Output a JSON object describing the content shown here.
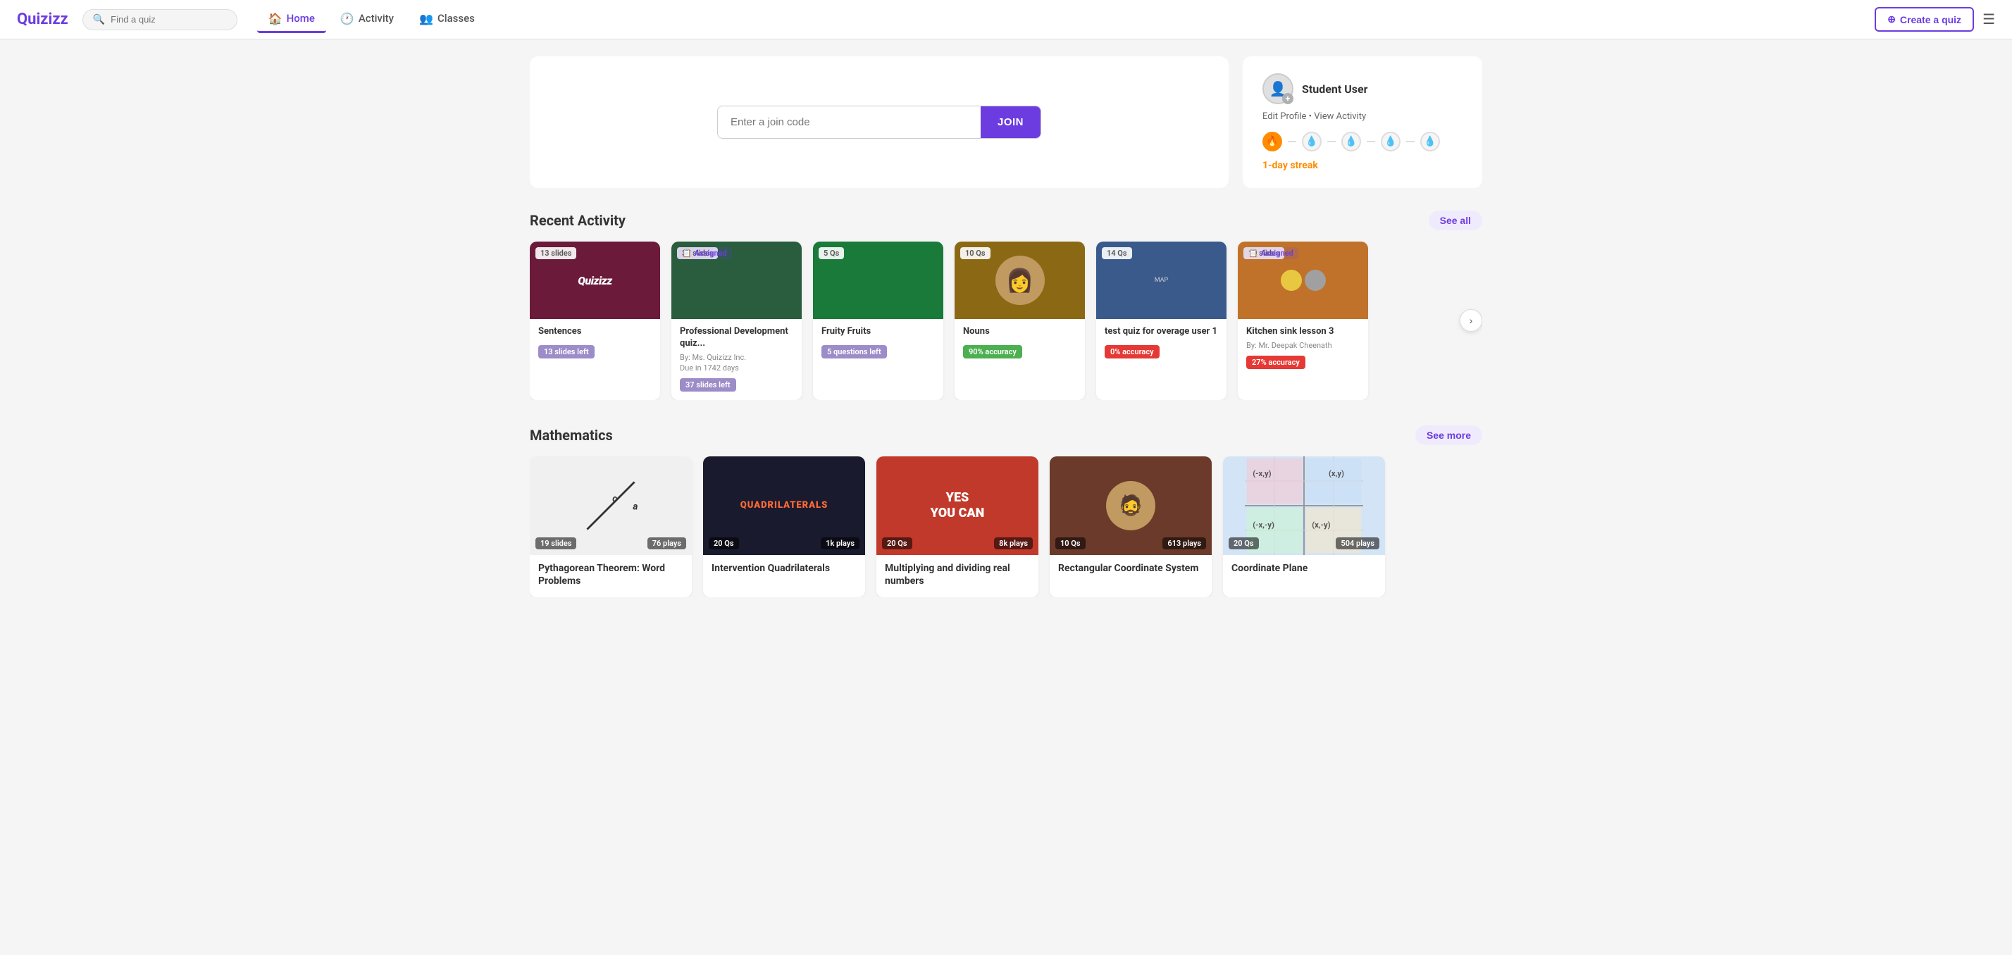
{
  "app": {
    "logo": "Quizizz",
    "search_placeholder": "Find a quiz"
  },
  "navbar": {
    "links": [
      {
        "id": "home",
        "label": "Home",
        "icon": "🏠",
        "active": true
      },
      {
        "id": "activity",
        "label": "Activity",
        "icon": "🕐",
        "active": false
      },
      {
        "id": "classes",
        "label": "Classes",
        "icon": "👥",
        "active": false
      }
    ],
    "create_label": "Create a quiz",
    "menu_icon": "☰"
  },
  "hero": {
    "join_placeholder": "Enter a join code",
    "join_button": "JOIN"
  },
  "profile": {
    "name": "Student User",
    "edit_label": "Edit Profile",
    "view_label": "View Activity",
    "streak_label": "1-day streak",
    "streak_days": [
      {
        "active": true
      },
      {
        "active": false
      },
      {
        "active": false
      },
      {
        "active": false
      },
      {
        "active": false
      }
    ]
  },
  "recent_activity": {
    "section_title": "Recent Activity",
    "see_all_label": "See all",
    "cards": [
      {
        "id": "sentences",
        "title": "Sentences",
        "badge_type": "slides",
        "badge_label": "13 slides",
        "is_assigned": false,
        "bg_color": "#6b1a3a",
        "progress_label": "13 slides left",
        "progress_type": "gray"
      },
      {
        "id": "professional-dev",
        "title": "Professional Development quiz...",
        "badge_type": "slides",
        "badge_label": "37 slides",
        "is_assigned": true,
        "bg_color": "#2a5c3e",
        "meta_by": "By: Ms. Quizizz Inc.",
        "meta_due": "Due in 1742 days",
        "progress_label": "37 slides left",
        "progress_type": "gray"
      },
      {
        "id": "fruity-fruits",
        "title": "Fruity Fruits",
        "badge_type": "qs",
        "badge_label": "5 Qs",
        "is_assigned": false,
        "bg_color": "#1a7a3a",
        "progress_label": "5 questions left",
        "progress_type": "gray"
      },
      {
        "id": "nouns",
        "title": "Nouns",
        "badge_type": "qs",
        "badge_label": "10 Qs",
        "is_assigned": false,
        "bg_color": "#8b6914",
        "progress_label": "90% accuracy",
        "progress_type": "green"
      },
      {
        "id": "test-quiz",
        "title": "test quiz for overage user 1",
        "badge_type": "qs",
        "badge_label": "14 Qs",
        "is_assigned": false,
        "bg_color": "#4a6fa5",
        "progress_label": "0% accuracy",
        "progress_type": "red"
      },
      {
        "id": "kitchen-sink",
        "title": "Kitchen sink lesson 3",
        "badge_type": "slides",
        "badge_label": "19 slides",
        "is_assigned": true,
        "bg_color": "#c0722a",
        "meta_by": "By: Mr. Deepak Cheenath",
        "progress_label": "27% accuracy",
        "progress_type": "red"
      }
    ]
  },
  "mathematics": {
    "section_title": "Mathematics",
    "see_more_label": "See more",
    "cards": [
      {
        "id": "pythagorean",
        "title": "Pythagorean Theorem: Word Problems",
        "slides_label": "19 slides",
        "plays_label": "76 plays",
        "bg": "pyth",
        "bg_color": "#f0f0f0"
      },
      {
        "id": "quadrilaterals",
        "title": "Intervention Quadrilaterals",
        "slides_label": "20 Qs",
        "plays_label": "1k plays",
        "bg": "dark",
        "bg_color": "#1a1a2e",
        "thumb_text": "QUADRILATERALS"
      },
      {
        "id": "multiplying",
        "title": "Multiplying and dividing real numbers",
        "slides_label": "20 Qs",
        "plays_label": "8k plays",
        "bg": "red",
        "bg_color": "#c0392b",
        "thumb_text": "YES YOU CAN"
      },
      {
        "id": "rectangular-coord",
        "title": "Rectangular Coordinate System",
        "slides_label": "10 Qs",
        "plays_label": "613 plays",
        "bg": "brown",
        "bg_color": "#6b3a2a"
      },
      {
        "id": "coordinate-plane",
        "title": "Coordinate Plane",
        "slides_label": "20 Qs",
        "plays_label": "504 plays",
        "bg": "grid",
        "bg_color": "#d4e4f7"
      }
    ]
  }
}
